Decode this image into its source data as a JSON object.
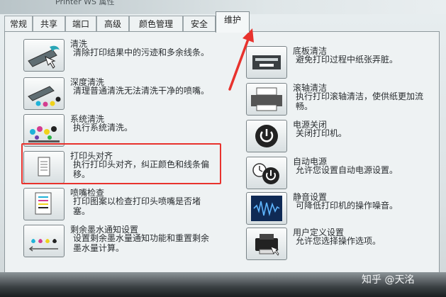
{
  "window": {
    "title": "Printer WS 属性"
  },
  "tabs": [
    {
      "label": "常规"
    },
    {
      "label": "共享"
    },
    {
      "label": "端口"
    },
    {
      "label": "高级"
    },
    {
      "label": "颜色管理"
    },
    {
      "label": "安全"
    },
    {
      "label": "维护"
    }
  ],
  "active_tab": "维护",
  "left_items": [
    {
      "title": "清洗",
      "desc": [
        "清除打印结果中的污迹和多余线条。"
      ],
      "icon": "cleaning-icon"
    },
    {
      "title": "深度清洗",
      "desc": [
        "清理普通清洗无法清洗干净的喷嘴。"
      ],
      "icon": "deep-cleaning-icon"
    },
    {
      "title": "系统清洗",
      "desc": [
        "执行系统清洗。"
      ],
      "icon": "system-cleaning-icon"
    },
    {
      "title": "打印头对齐",
      "desc": [
        "执行打印头对齐，纠正颜色和线条偏",
        "移。"
      ],
      "icon": "print-head-alignment-icon"
    },
    {
      "title": "喷嘴检查",
      "desc": [
        "打印图案以检查打印头喷嘴是否堵",
        "塞。"
      ],
      "icon": "nozzle-check-icon"
    },
    {
      "title": "剩余墨水通知设置",
      "desc": [
        "设置剩余墨水量通知功能和重置剩余",
        "墨水量计算。"
      ],
      "icon": "ink-notification-icon"
    }
  ],
  "right_items": [
    {
      "title": "底板清洁",
      "desc": [
        "避免打印过程中纸张弄脏。"
      ],
      "icon": "bottom-plate-cleaning-icon"
    },
    {
      "title": "滚轴清洁",
      "desc": [
        "执行打印滚轴清洁，使供纸更加流",
        "畅。"
      ],
      "icon": "roller-cleaning-icon"
    },
    {
      "title": "电源关闭",
      "desc": [
        "关闭打印机。"
      ],
      "icon": "power-off-icon"
    },
    {
      "title": "自动电源",
      "desc": [
        "允许您设置自动电源设置。"
      ],
      "icon": "auto-power-icon"
    },
    {
      "title": "静音设置",
      "desc": [
        "可降低打印机的操作噪音。"
      ],
      "icon": "quiet-mode-icon"
    },
    {
      "title": "用户定义设置",
      "desc": [
        "允许您选择操作选项。"
      ],
      "icon": "custom-settings-icon"
    }
  ],
  "watermark": "知乎 @天洺",
  "colors": {
    "highlight": "#e8322d",
    "panel": "#eef2f3"
  }
}
